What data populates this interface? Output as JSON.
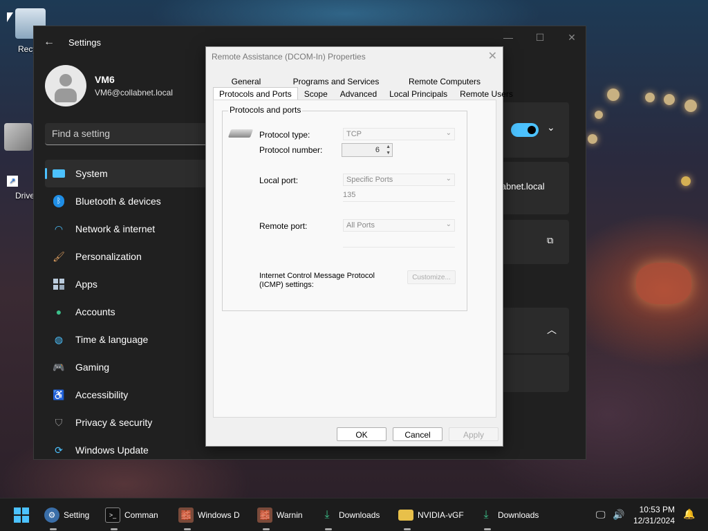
{
  "desktop": {
    "icons": [
      {
        "label": "Recy"
      },
      {
        "label": "Drive"
      }
    ]
  },
  "settings": {
    "title": "Settings",
    "user": {
      "name": "VM6",
      "email": "VM6@collabnet.local"
    },
    "search_placeholder": "Find a setting",
    "nav": [
      {
        "label": "System",
        "icon": "system-icon",
        "active": true
      },
      {
        "label": "Bluetooth & devices",
        "icon": "bluetooth-icon"
      },
      {
        "label": "Network & internet",
        "icon": "wifi-icon"
      },
      {
        "label": "Personalization",
        "icon": "brush-icon"
      },
      {
        "label": "Apps",
        "icon": "apps-icon"
      },
      {
        "label": "Accounts",
        "icon": "person-icon"
      },
      {
        "label": "Time & language",
        "icon": "globe-clock-icon"
      },
      {
        "label": "Gaming",
        "icon": "gamepad-icon"
      },
      {
        "label": "Accessibility",
        "icon": "accessibility-icon"
      },
      {
        "label": "Privacy & security",
        "icon": "shield-icon"
      },
      {
        "label": "Windows Update",
        "icon": "update-icon"
      }
    ],
    "right_partial_text": "llabnet.local",
    "toggle_on": true
  },
  "dialog": {
    "title": "Remote Assistance (DCOM-In) Properties",
    "tabs_row1": [
      "General",
      "Programs and Services",
      "Remote Computers"
    ],
    "tabs_row2": [
      "Protocols and Ports",
      "Scope",
      "Advanced",
      "Local Principals",
      "Remote Users"
    ],
    "active_tab": "Protocols and Ports",
    "group_title": "Protocols and ports",
    "protocol_type_label": "Protocol type:",
    "protocol_type_value": "TCP",
    "protocol_number_label": "Protocol number:",
    "protocol_number_value": "6",
    "local_port_label": "Local port:",
    "local_port_value": "Specific Ports",
    "local_port_text": "135",
    "remote_port_label": "Remote port:",
    "remote_port_value": "All Ports",
    "icmp_label_1": "Internet Control Message Protocol",
    "icmp_label_2": "(ICMP) settings:",
    "customize_label": "Customize...",
    "ok_label": "OK",
    "cancel_label": "Cancel",
    "apply_label": "Apply"
  },
  "taskbar": {
    "items": [
      {
        "label": "Setting",
        "icon": "settings-gear-icon"
      },
      {
        "label": "Comman",
        "icon": "terminal-icon"
      },
      {
        "label": "Windows D",
        "icon": "windows-defender-icon"
      },
      {
        "label": "Warnin",
        "icon": "warning-app-icon"
      },
      {
        "label": "Downloads",
        "icon": "download-icon"
      },
      {
        "label": "NVIDIA-vGF",
        "icon": "folder-icon"
      },
      {
        "label": "Downloads",
        "icon": "download-icon"
      }
    ],
    "time": "10:53 PM",
    "date": "12/31/2024"
  },
  "colors": {
    "accent": "#4cc2ff",
    "settings_bg": "#202020",
    "dialog_bg": "#f0f0f0"
  }
}
